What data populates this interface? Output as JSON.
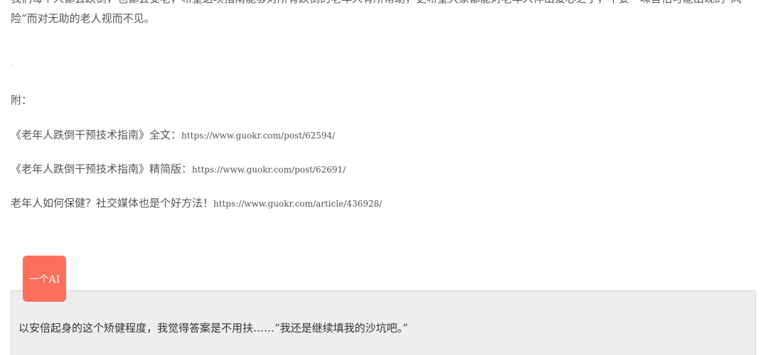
{
  "article": {
    "top_paragraph": "我们每个人都会跌倒，也都会变老，希望这项指南能够对所有跌倒的老年人有所帮助，更希望大家都能对老年人伸出爱心之手，不要一味害怕可能出现的“风险”而对无助的老人视而不见。",
    "separator_dot": ".",
    "appendix_label": "附：",
    "links": [
      {
        "title": "《老年人跌倒干预技术指南》全文：",
        "url": "https://www.guokr.com/post/62594/"
      },
      {
        "title": "《老年人跌倒干预技术指南》精简版：",
        "url": "https://www.guokr.com/post/62691/"
      },
      {
        "title": "老年人如何保健？社交媒体也是个好方法！",
        "url": "https://www.guokr.com/article/436928/"
      }
    ]
  },
  "comment": {
    "author": "一个AI",
    "text": "以安倍起身的这个矫健程度，我觉得答案是不用扶……“我还是继续填我的沙坑吧。”",
    "badge_color": "#fb6f5c"
  }
}
